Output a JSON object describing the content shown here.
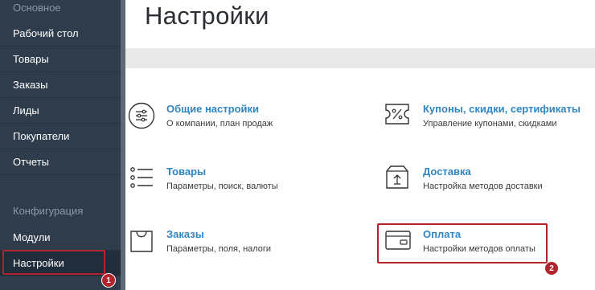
{
  "sidebar": {
    "section_basic": "Основное",
    "items": [
      {
        "label": "Рабочий стол"
      },
      {
        "label": "Товары"
      },
      {
        "label": "Заказы"
      },
      {
        "label": "Лиды"
      },
      {
        "label": "Покупатели"
      },
      {
        "label": "Отчеты"
      }
    ],
    "section_config": "Конфигурация",
    "config_items": [
      {
        "label": "Модули"
      },
      {
        "label": "Настройки"
      }
    ]
  },
  "page": {
    "title": "Настройки"
  },
  "cards": [
    {
      "title": "Общие настройки",
      "subtitle": "О компании, план продаж",
      "icon": "sliders-icon"
    },
    {
      "title": "Купоны, скидки, сертификаты",
      "subtitle": "Управление купонами, скидками",
      "icon": "coupon-icon"
    },
    {
      "title": "Товары",
      "subtitle": "Параметры, поиск, валюты",
      "icon": "list-icon"
    },
    {
      "title": "Доставка",
      "subtitle": "Настройка методов доставки",
      "icon": "delivery-box-icon"
    },
    {
      "title": "Заказы",
      "subtitle": "Параметры, поля, налоги",
      "icon": "shopping-bag-icon"
    },
    {
      "title": "Оплата",
      "subtitle": "Настройки методов оплаты",
      "icon": "credit-card-icon"
    }
  ],
  "annotations": {
    "step1": "1",
    "step2": "2",
    "color": "#b3232b"
  },
  "colors": {
    "sidebar_bg": "#2f3c4b",
    "link": "#2f86c2"
  }
}
